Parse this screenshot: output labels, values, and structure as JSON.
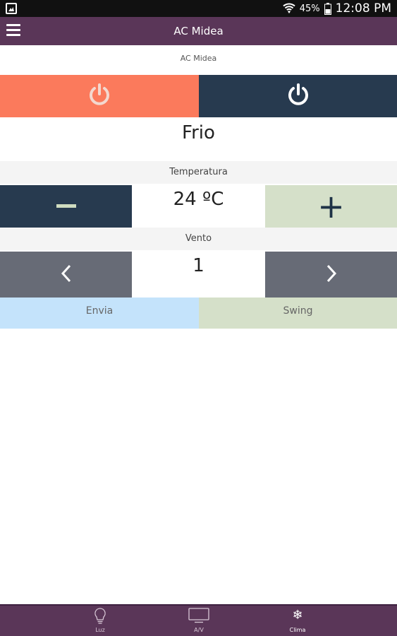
{
  "status_bar": {
    "battery_percent": "45%",
    "time": "12:08 PM"
  },
  "app_bar": {
    "title": "AC Midea"
  },
  "device": {
    "name": "AC Midea"
  },
  "power": {
    "on_icon": "power-icon",
    "off_icon": "power-icon"
  },
  "mode": {
    "label": "Frio"
  },
  "temperature": {
    "header": "Temperatura",
    "value": "24 ºC",
    "decrease_icon": "minus-icon",
    "increase_icon": "plus-icon"
  },
  "wind": {
    "header": "Vento",
    "value": "1",
    "prev_icon": "chevron-left-icon",
    "next_icon": "chevron-right-icon"
  },
  "actions": {
    "send_label": "Envia",
    "swing_label": "Swing"
  },
  "bottom_nav": {
    "items": [
      {
        "label": "Luz",
        "icon": "lightbulb-icon"
      },
      {
        "label": "A/V",
        "icon": "tv-icon"
      },
      {
        "label": "Clima",
        "icon": "snowflake-icon"
      }
    ]
  },
  "colors": {
    "app_bar": "#5a3658",
    "power_on": "#fb7a5c",
    "power_off": "#273a4f",
    "accent_green": "#d5e0c9",
    "send_blue": "#c4e3fb",
    "wind_gray": "#676b76"
  }
}
